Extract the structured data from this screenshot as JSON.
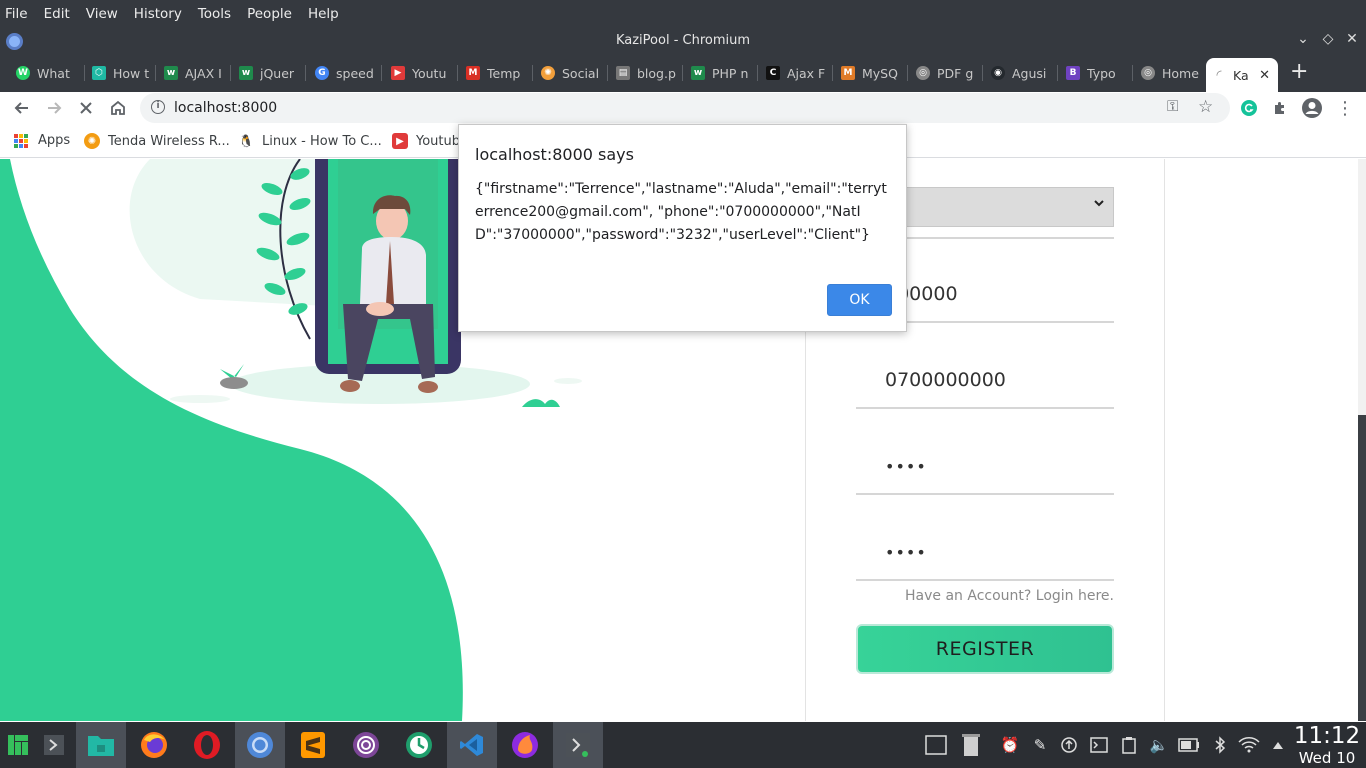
{
  "menubar": {
    "items": [
      "File",
      "Edit",
      "View",
      "History",
      "Tools",
      "People",
      "Help"
    ]
  },
  "window": {
    "title": "KaziPool - Chromium"
  },
  "tabs": [
    {
      "label": "What",
      "color": "#25d366",
      "glyph": "W"
    },
    {
      "label": "How t",
      "color": "#1fb9a3",
      "glyph": "⬡"
    },
    {
      "label": "AJAX I",
      "color": "#1f8a4c",
      "glyph": "w"
    },
    {
      "label": "jQuer",
      "color": "#1f8a4c",
      "glyph": "w"
    },
    {
      "label": "speed",
      "color": "#4285f4",
      "glyph": "G"
    },
    {
      "label": "Youtu",
      "color": "#e03a3a",
      "glyph": "▶"
    },
    {
      "label": "Temp",
      "color": "#d93025",
      "glyph": "M"
    },
    {
      "label": "Social",
      "color": "#f29f3b",
      "glyph": "✺"
    },
    {
      "label": "blog.p",
      "color": "#777777",
      "glyph": "▤"
    },
    {
      "label": "PHP n",
      "color": "#1f8a4c",
      "glyph": "w"
    },
    {
      "label": "Ajax F",
      "color": "#111111",
      "glyph": "C"
    },
    {
      "label": "MySQ",
      "color": "#e07b28",
      "glyph": "M"
    },
    {
      "label": "PDF g",
      "color": "#888888",
      "glyph": "◎"
    },
    {
      "label": "Agusi",
      "color": "#24292e",
      "glyph": "◉"
    },
    {
      "label": "Typo",
      "color": "#6f42c1",
      "glyph": "B"
    },
    {
      "label": "Home",
      "color": "#888888",
      "glyph": "◎"
    },
    {
      "label": "Ka",
      "color": "#bbbbbb",
      "glyph": "◜"
    }
  ],
  "toolbar": {
    "url": "localhost:8000"
  },
  "bookmarks": [
    {
      "label": "Apps"
    },
    {
      "label": "Tenda Wireless R...",
      "color": "#f39c12",
      "glyph": "✺"
    },
    {
      "label": "Linux - How To C...",
      "color": "#333333",
      "glyph": "🐧"
    },
    {
      "label": "Youtub",
      "color": "#e03a3a",
      "glyph": "▶"
    }
  ],
  "form": {
    "user_level_selected": "ent",
    "natid_value": "000000",
    "phone_value": "0700000000",
    "password_mask": "••••",
    "confirm_mask": "••••",
    "login_link": "Have an Account? Login here.",
    "register_label": "REGISTER"
  },
  "alert": {
    "title": "localhost:8000 says",
    "message": "{\"firstname\":\"Terrence\",\"lastname\":\"Aluda\",\"email\":\"terryterrence200@gmail.com\",\n\"phone\":\"0700000000\",\"NatID\":\"37000000\",\"password\":\"3232\",\"userLevel\":\"Client\"}",
    "ok_label": "OK"
  },
  "clock": {
    "time": "11:12",
    "date": "Wed 10"
  },
  "colors": {
    "accent_green": "#2fcf93",
    "alert_button": "#3b88e8",
    "chrome_dark": "#35393f"
  }
}
